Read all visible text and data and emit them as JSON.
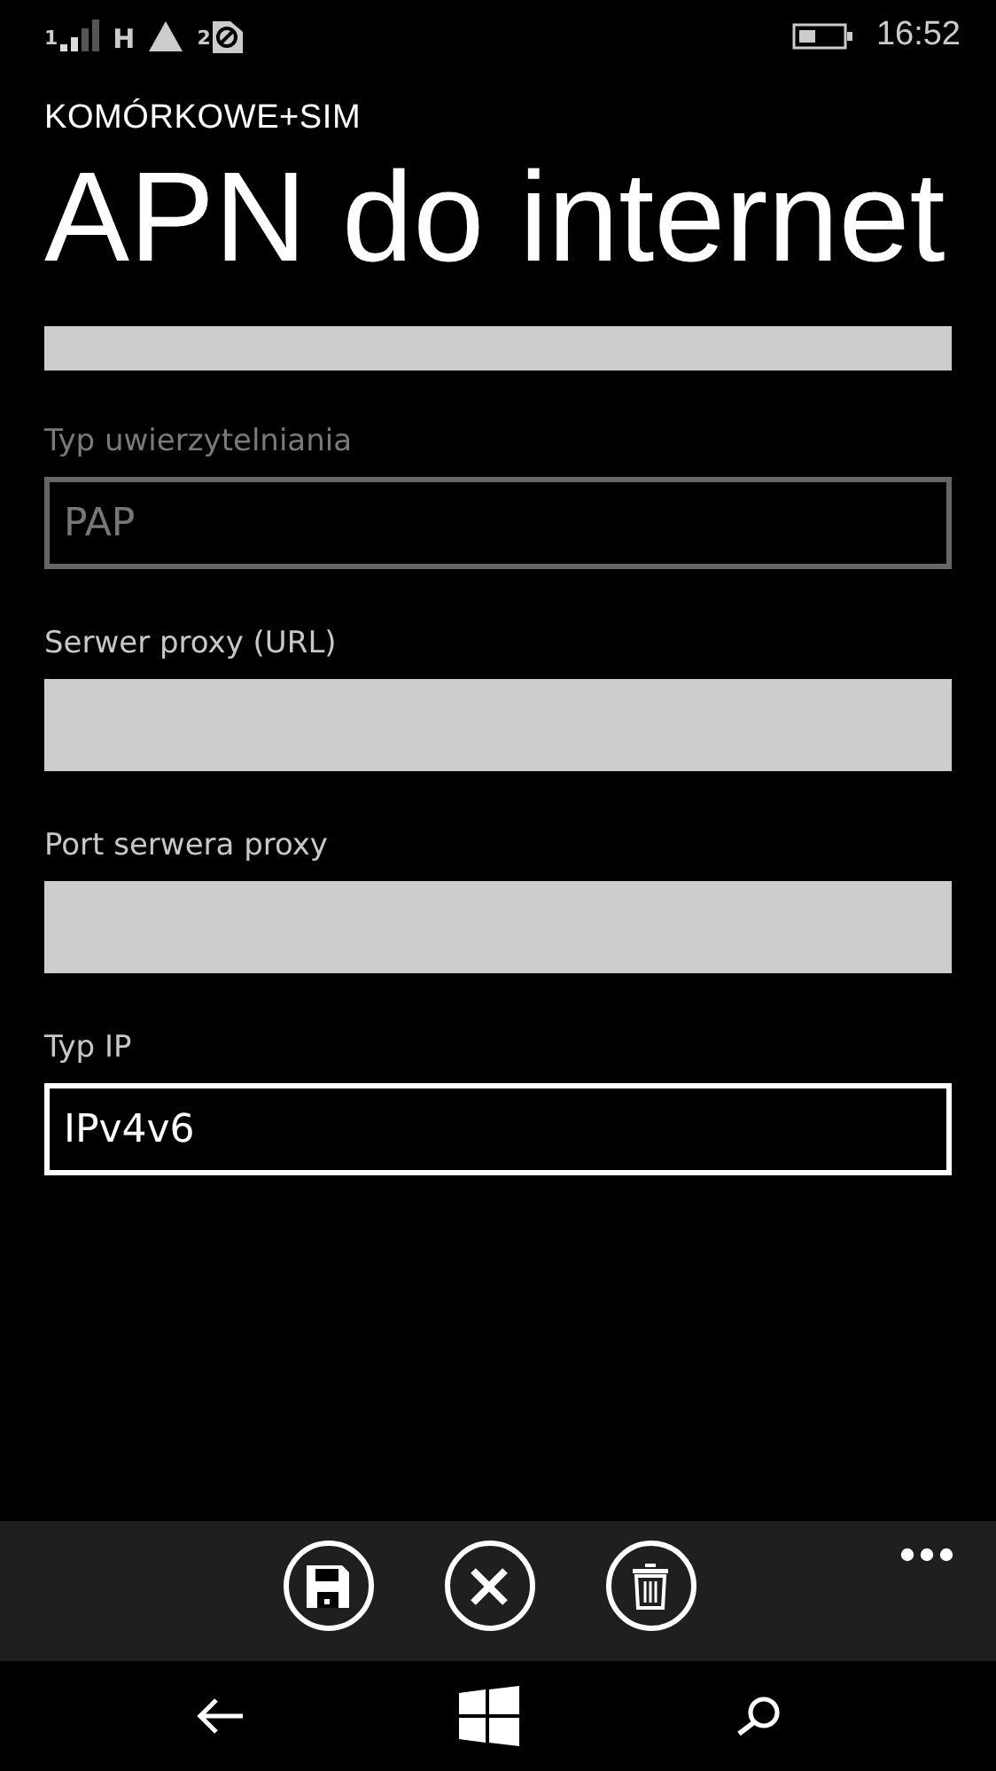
{
  "status_bar": {
    "sim1_label": "1",
    "network_type": "H",
    "sim2_label": "2",
    "time": "16:52"
  },
  "header": {
    "section": "KOMÓRKOWE+SIM",
    "title": "APN do internet"
  },
  "fields": [
    {
      "kind": "text",
      "disabled": false
    },
    {
      "kind": "select",
      "label": "Typ uwierzytelniania",
      "value": "PAP",
      "disabled": true
    },
    {
      "kind": "text",
      "label": "Serwer proxy (URL)",
      "disabled": false
    },
    {
      "kind": "text",
      "label": "Port serwera proxy",
      "disabled": false
    },
    {
      "kind": "select",
      "label": "Typ IP",
      "value": "IPv4v6",
      "disabled": false
    }
  ],
  "app_bar": {
    "buttons": [
      {
        "kind": "save"
      },
      {
        "kind": "cancel"
      },
      {
        "kind": "delete"
      }
    ]
  }
}
